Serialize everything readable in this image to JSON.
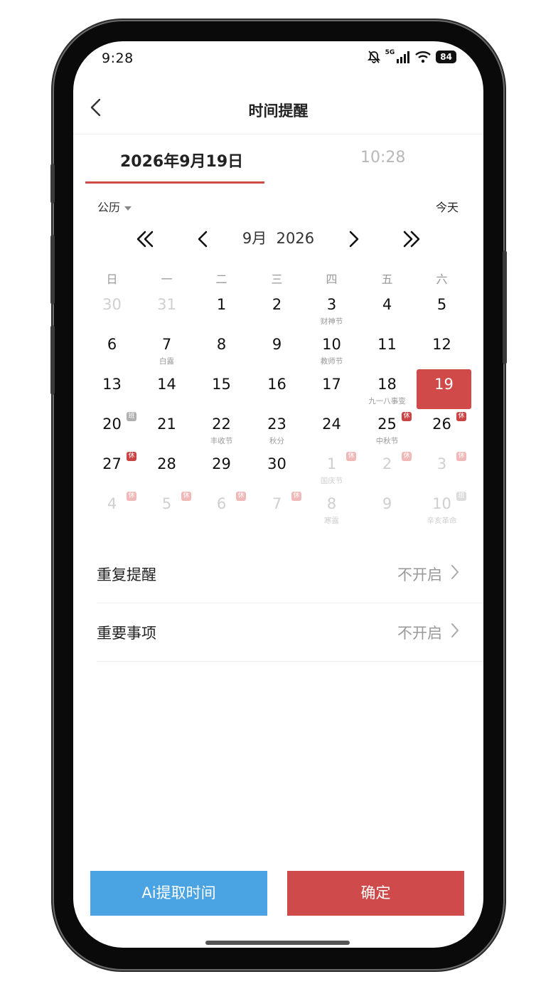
{
  "status_bar": {
    "time": "9:28",
    "network": "5G",
    "battery": "84"
  },
  "header": {
    "title": "时间提醒"
  },
  "tabs": {
    "date": "2026年9月19日",
    "time": "10:28"
  },
  "calendar": {
    "type_label": "公历",
    "today_label": "今天",
    "month_label": "9月  2026",
    "weekdays": [
      "日",
      "一",
      "二",
      "三",
      "四",
      "五",
      "六"
    ],
    "rows": [
      [
        {
          "d": "30",
          "dim": true
        },
        {
          "d": "31",
          "dim": true
        },
        {
          "d": "1"
        },
        {
          "d": "2"
        },
        {
          "d": "3",
          "sub": "财神节"
        },
        {
          "d": "4"
        },
        {
          "d": "5"
        }
      ],
      [
        {
          "d": "6"
        },
        {
          "d": "7",
          "sub": "白露"
        },
        {
          "d": "8"
        },
        {
          "d": "9"
        },
        {
          "d": "10",
          "sub": "教师节"
        },
        {
          "d": "11"
        },
        {
          "d": "12"
        }
      ],
      [
        {
          "d": "13"
        },
        {
          "d": "14"
        },
        {
          "d": "15"
        },
        {
          "d": "16"
        },
        {
          "d": "17"
        },
        {
          "d": "18",
          "sub": "九一八事变"
        },
        {
          "d": "19",
          "selected": true
        }
      ],
      [
        {
          "d": "20",
          "badge": "班",
          "badge_type": "work"
        },
        {
          "d": "21"
        },
        {
          "d": "22",
          "sub": "丰收节"
        },
        {
          "d": "23",
          "sub": "秋分"
        },
        {
          "d": "24"
        },
        {
          "d": "25",
          "sub": "中秋节",
          "badge": "休",
          "badge_type": "rest"
        },
        {
          "d": "26",
          "badge": "休",
          "badge_type": "rest"
        }
      ],
      [
        {
          "d": "27",
          "badge": "休",
          "badge_type": "rest"
        },
        {
          "d": "28"
        },
        {
          "d": "29"
        },
        {
          "d": "30"
        },
        {
          "d": "1",
          "dim": true,
          "sub": "国庆节",
          "badge": "休",
          "badge_type": "faint"
        },
        {
          "d": "2",
          "dim": true,
          "badge": "休",
          "badge_type": "faint"
        },
        {
          "d": "3",
          "dim": true,
          "badge": "休",
          "badge_type": "faint"
        }
      ],
      [
        {
          "d": "4",
          "dim": true,
          "badge": "休",
          "badge_type": "faint"
        },
        {
          "d": "5",
          "dim": true,
          "badge": "休",
          "badge_type": "faint"
        },
        {
          "d": "6",
          "dim": true,
          "badge": "休",
          "badge_type": "faint"
        },
        {
          "d": "7",
          "dim": true,
          "badge": "休",
          "badge_type": "faint"
        },
        {
          "d": "8",
          "dim": true,
          "sub": "寒露"
        },
        {
          "d": "9",
          "dim": true
        },
        {
          "d": "10",
          "dim": true,
          "sub": "辛亥革命",
          "badge": "班",
          "badge_type": "faintw"
        }
      ]
    ]
  },
  "settings": [
    {
      "label": "重复提醒",
      "value": "不开启"
    },
    {
      "label": "重要事项",
      "value": "不开启"
    }
  ],
  "buttons": {
    "ai_extract": "Ai提取时间",
    "confirm": "确定"
  },
  "colors": {
    "accent_red": "#cf4b4b",
    "ai_blue": "#4aa3e3"
  }
}
